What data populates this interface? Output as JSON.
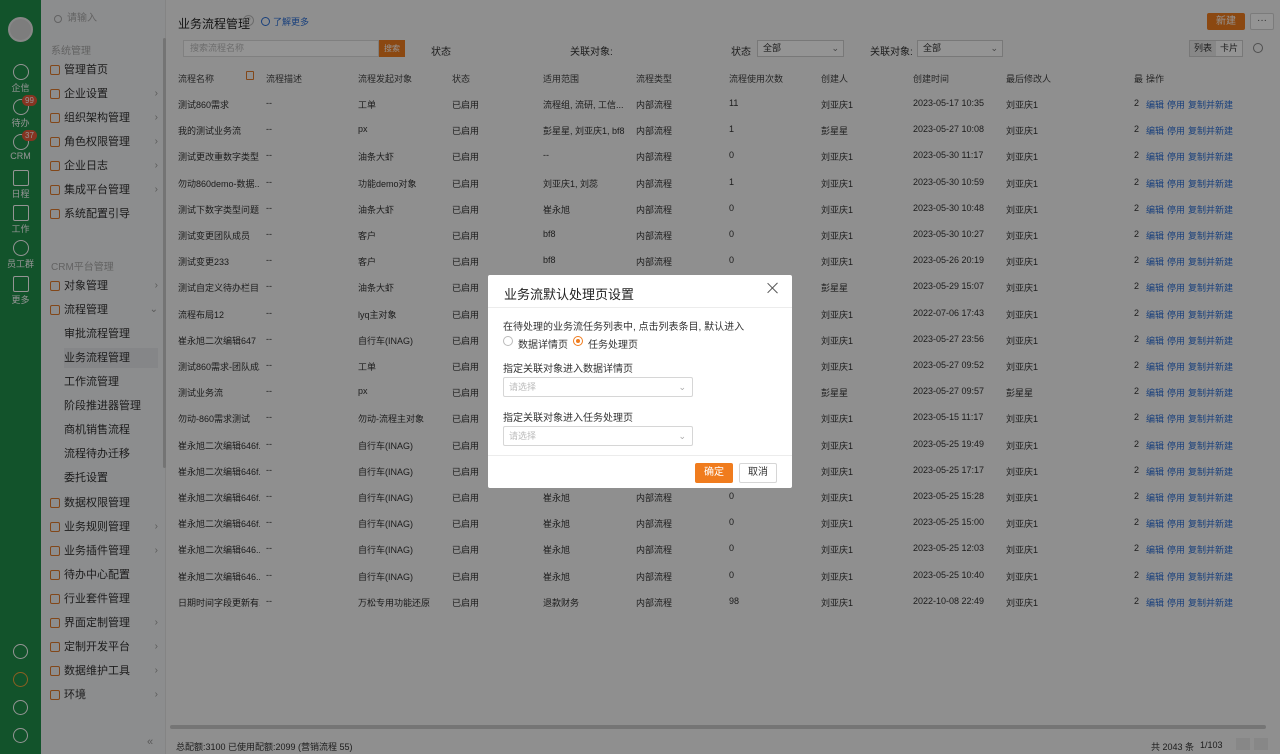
{
  "rail": {
    "items": [
      {
        "label": "企信",
        "icon": "chat-icon"
      },
      {
        "label": "待办",
        "icon": "check-circle-icon",
        "badge": "99"
      },
      {
        "label": "CRM",
        "icon": "crm-icon",
        "badge": "37"
      },
      {
        "label": "日程",
        "icon": "calendar-icon"
      },
      {
        "label": "工作",
        "icon": "briefcase-icon"
      },
      {
        "label": "员工群",
        "icon": "database-icon"
      },
      {
        "label": "更多",
        "icon": "grid-icon"
      }
    ]
  },
  "sidebar": {
    "search_placeholder": "请输入",
    "group1": "系统管理",
    "group2": "CRM平台管理",
    "items1": [
      {
        "label": "管理首页",
        "arrow": ""
      },
      {
        "label": "企业设置",
        "arrow": "›"
      },
      {
        "label": "组织架构管理",
        "arrow": "›"
      },
      {
        "label": "角色权限管理",
        "arrow": "›"
      },
      {
        "label": "企业日志",
        "arrow": "›"
      },
      {
        "label": "集成平台管理",
        "arrow": "›"
      },
      {
        "label": "系统配置引导",
        "arrow": ""
      }
    ],
    "items2a": [
      {
        "label": "对象管理",
        "arrow": "›"
      },
      {
        "label": "流程管理",
        "arrow": "⌄"
      }
    ],
    "subs": [
      "审批流程管理",
      "业务流程管理",
      "工作流管理",
      "阶段推进器管理",
      "商机销售流程",
      "流程待办迁移",
      "委托设置"
    ],
    "items2b": [
      {
        "label": "数据权限管理",
        "arrow": ""
      },
      {
        "label": "业务规则管理",
        "arrow": "›"
      },
      {
        "label": "业务插件管理",
        "arrow": "›"
      },
      {
        "label": "待办中心配置",
        "arrow": ""
      },
      {
        "label": "行业套件管理",
        "arrow": ""
      },
      {
        "label": "界面定制管理",
        "arrow": "›"
      },
      {
        "label": "定制开发平台",
        "arrow": "›"
      },
      {
        "label": "数据维护工具",
        "arrow": "›"
      },
      {
        "label": "环境",
        "arrow": "›"
      }
    ],
    "collapse": "«"
  },
  "header": {
    "title": "业务流程管理",
    "learn_more": "了解更多",
    "new_button": "新建",
    "more_button": "···"
  },
  "filters": {
    "search_placeholder": "搜索流程名称",
    "search_button": "搜索",
    "status_label": "状态",
    "related_label": "关联对象:",
    "status2_label": "状态",
    "status_value": "全部",
    "related2_label": "关联对象:",
    "related_value": "全部",
    "view_list": "列表",
    "view_card": "卡片"
  },
  "table": {
    "headers": [
      "流程名称",
      "流程描述",
      "流程发起对象",
      "状态",
      "适用范围",
      "流程类型",
      "流程使用次数",
      "创建人",
      "创建时间",
      "最后修改人",
      "最",
      "操作"
    ],
    "ops": [
      "编辑",
      "停用",
      "复制并新建"
    ],
    "rows": [
      [
        "测试860需求",
        "--",
        "工单",
        "已启用",
        "流程组, 流研, 工信...",
        "内部流程",
        "11",
        "刘亚庆1",
        "2023-05-17 10:35",
        "刘亚庆1",
        "2"
      ],
      [
        "我的测试业务流",
        "--",
        "px",
        "已启用",
        "彭星星, 刘亚庆1, bf8",
        "内部流程",
        "1",
        "彭星星",
        "2023-05-27 10:08",
        "刘亚庆1",
        "2"
      ],
      [
        "测试更改重数字类型",
        "--",
        "油条大虾",
        "已启用",
        "--",
        "内部流程",
        "0",
        "刘亚庆1",
        "2023-05-30 11:17",
        "刘亚庆1",
        "2"
      ],
      [
        "勿动860demo-数据...",
        "--",
        "功能demo对象",
        "已启用",
        "刘亚庆1, 刘蕊",
        "内部流程",
        "1",
        "刘亚庆1",
        "2023-05-30 10:59",
        "刘亚庆1",
        "2"
      ],
      [
        "测试下数字类型问题",
        "--",
        "油条大虾",
        "已启用",
        "崔永旭",
        "内部流程",
        "0",
        "刘亚庆1",
        "2023-05-30 10:48",
        "刘亚庆1",
        "2"
      ],
      [
        "测试变更团队成员",
        "--",
        "客户",
        "已启用",
        "bf8",
        "内部流程",
        "0",
        "刘亚庆1",
        "2023-05-30 10:27",
        "刘亚庆1",
        "2"
      ],
      [
        "测试变更233",
        "--",
        "客户",
        "已启用",
        "bf8",
        "内部流程",
        "0",
        "刘亚庆1",
        "2023-05-26 20:19",
        "刘亚庆1",
        "2"
      ],
      [
        "测试自定义待办栏目",
        "--",
        "油条大虾",
        "已启用",
        "",
        "",
        "",
        "彭星星",
        "2023-05-29 15:07",
        "刘亚庆1",
        "2"
      ],
      [
        "流程布局12",
        "--",
        "lyq主对象",
        "已启用",
        "",
        "",
        "",
        "刘亚庆1",
        "2022-07-06 17:43",
        "刘亚庆1",
        "2"
      ],
      [
        "崔永旭二次编辑647",
        "--",
        "自行车(INAG)",
        "已启用",
        "",
        "",
        "",
        "刘亚庆1",
        "2023-05-27 23:56",
        "刘亚庆1",
        "2"
      ],
      [
        "测试860需求-团队成...",
        "--",
        "工单",
        "已启用",
        "",
        "",
        "",
        "刘亚庆1",
        "2023-05-27 09:52",
        "刘亚庆1",
        "2"
      ],
      [
        "测试业务流",
        "--",
        "px",
        "已启用",
        "",
        "",
        "",
        "彭星星",
        "2023-05-27 09:57",
        "彭星星",
        "2"
      ],
      [
        "勿动-860需求测试",
        "--",
        "勿动-流程主对象",
        "已启用",
        "",
        "",
        "",
        "刘亚庆1",
        "2023-05-15 11:17",
        "刘亚庆1",
        "2"
      ],
      [
        "崔永旭二次编辑646f...",
        "--",
        "自行车(INAG)",
        "已启用",
        "",
        "",
        "",
        "刘亚庆1",
        "2023-05-25 19:49",
        "刘亚庆1",
        "2"
      ],
      [
        "崔永旭二次编辑646f...",
        "--",
        "自行车(INAG)",
        "已启用",
        "",
        "",
        "",
        "刘亚庆1",
        "2023-05-25 17:17",
        "刘亚庆1",
        "2"
      ],
      [
        "崔永旭二次编辑646f...",
        "--",
        "自行车(INAG)",
        "已启用",
        "崔永旭",
        "内部流程",
        "0",
        "刘亚庆1",
        "2023-05-25 15:28",
        "刘亚庆1",
        "2"
      ],
      [
        "崔永旭二次编辑646f...",
        "--",
        "自行车(INAG)",
        "已启用",
        "崔永旭",
        "内部流程",
        "0",
        "刘亚庆1",
        "2023-05-25 15:00",
        "刘亚庆1",
        "2"
      ],
      [
        "崔永旭二次编辑646...",
        "--",
        "自行车(INAG)",
        "已启用",
        "崔永旭",
        "内部流程",
        "0",
        "刘亚庆1",
        "2023-05-25 12:03",
        "刘亚庆1",
        "2"
      ],
      [
        "崔永旭二次编辑646...",
        "--",
        "自行车(INAG)",
        "已启用",
        "崔永旭",
        "内部流程",
        "0",
        "刘亚庆1",
        "2023-05-25 10:40",
        "刘亚庆1",
        "2"
      ],
      [
        "日期时间字段更新有...",
        "--",
        "万松专用功能还原",
        "已启用",
        "退款财务",
        "内部流程",
        "98",
        "刘亚庆1",
        "2022-10-08 22:49",
        "刘亚庆1",
        "2"
      ]
    ]
  },
  "footer": {
    "quota": "总配额:3100 已使用配额:2099 (营销流程 55)",
    "total": "共 2043 条",
    "pager": "1/103"
  },
  "modal": {
    "title": "业务流默认处理页设置",
    "description": "在待处理的业务流任务列表中, 点击列表条目, 默认进入",
    "radio1": "数据详情页",
    "radio2": "任务处理页",
    "label1": "指定关联对象进入数据详情页",
    "select1_placeholder": "请选择",
    "label2": "指定关联对象进入任务处理页",
    "select2_placeholder": "请选择",
    "ok": "确定",
    "cancel": "取消"
  }
}
